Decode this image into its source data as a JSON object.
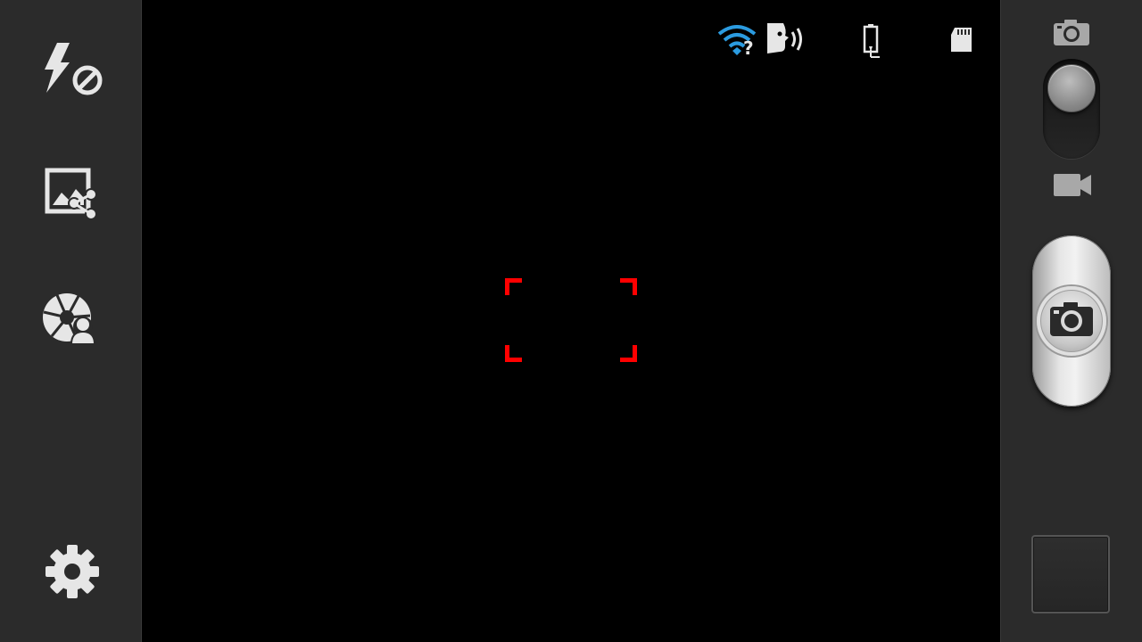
{
  "left_toolbar": {
    "buttons": [
      {
        "id": "flash",
        "icon": "flash-off-icon"
      },
      {
        "id": "share",
        "icon": "image-share-icon"
      },
      {
        "id": "shooting_mode",
        "icon": "shutter-person-icon"
      },
      {
        "id": "settings",
        "icon": "gear-icon"
      }
    ]
  },
  "status_bar": {
    "icons": [
      "wifi-unknown-icon",
      "voice-control-icon",
      "battery-charging-icon",
      "sd-card-icon"
    ],
    "wifi_symbol": "?",
    "wifi_color": "#2b9be0"
  },
  "viewfinder": {
    "focus_color": "#ff0000"
  },
  "right_toolbar": {
    "mode_switch": {
      "options": [
        "camera",
        "video"
      ],
      "selected": "camera"
    },
    "shutter_icon": "camera-icon",
    "thumbnail": "last-photo-thumbnail"
  },
  "colors": {
    "panel": "#2b2b2b",
    "icon": "#e6e6e6"
  }
}
